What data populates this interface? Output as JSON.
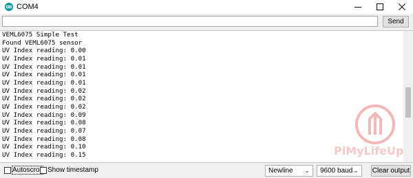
{
  "window": {
    "title": "COM4",
    "controls": [
      "minimize-icon",
      "maximize-icon",
      "close-icon"
    ]
  },
  "input": {
    "value": "",
    "send_label": "Send"
  },
  "output": {
    "lines": [
      "VEML6075 Simple Test",
      "Found VEML6075 sensor",
      "UV Index reading: 0.00",
      "UV Index reading: 0.01",
      "UV Index reading: 0.01",
      "UV Index reading: 0.01",
      "UV Index reading: 0.01",
      "UV Index reading: 0.02",
      "UV Index reading: 0.02",
      "UV Index reading: 0.02",
      "UV Index reading: 0.09",
      "UV Index reading: 0.08",
      "UV Index reading: 0.07",
      "UV Index reading: 0.08",
      "UV Index reading: 0.10",
      "UV Index reading: 0.15"
    ]
  },
  "watermark": {
    "text": "PiMyLifeUp",
    "color": "#f6c9c9"
  },
  "statusbar": {
    "autoscroll_label": "Autoscroll",
    "autoscroll_checked": false,
    "timestamp_label": "Show timestamp",
    "timestamp_checked": false,
    "line_ending": "Newline",
    "baud_rate": "9600 baud",
    "clear_label": "Clear output"
  },
  "colors": {
    "app_icon": "#00979d",
    "background": "#f0f0f0"
  }
}
